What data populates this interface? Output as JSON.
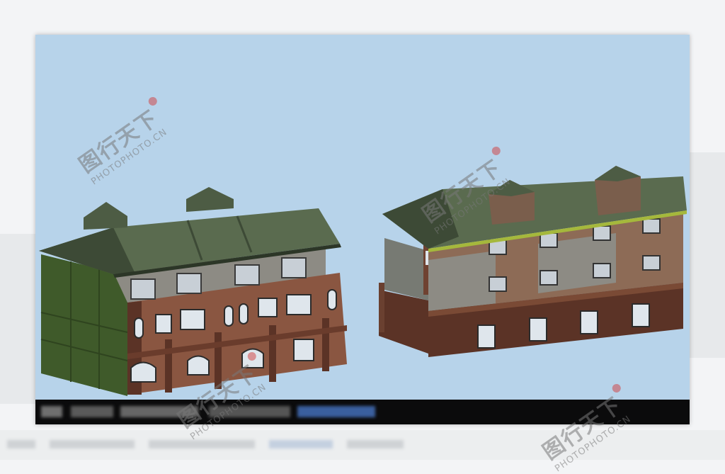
{
  "watermarks": [
    {
      "main": "图行天下",
      "sub": "PHOTOPHOTO.CN"
    },
    {
      "main": "图行天下",
      "sub": "PHOTOPHOTO.CN"
    },
    {
      "main": "图行天下",
      "sub": "PHOTOPHOTO.CN"
    },
    {
      "main": "图行天下",
      "sub": "PHOTOPHOTO.CN"
    }
  ],
  "colors": {
    "sky": "#b7d3ea",
    "roof": "#5a6b4f",
    "roof_dark": "#3d4a36",
    "upper_wall": "#8d8b84",
    "brick": "#8a5641",
    "brick_dark": "#5b3326",
    "side_wall": "#3f5a2a",
    "window": "#dfe6ec"
  }
}
